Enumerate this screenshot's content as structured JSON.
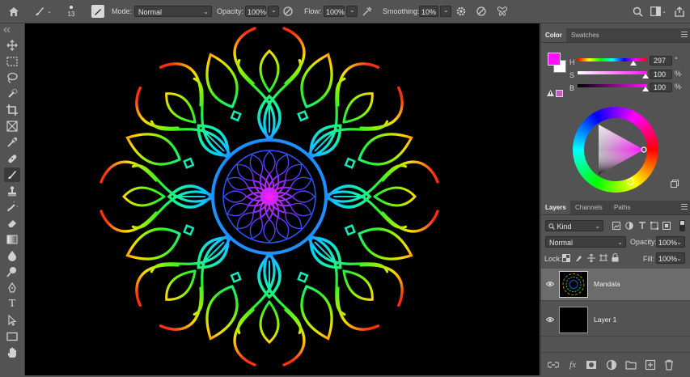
{
  "options_bar": {
    "brush_size": "13",
    "mode_label": "Mode:",
    "mode_value": "Normal",
    "opacity_label": "Opacity:",
    "opacity_value": "100%",
    "flow_label": "Flow:",
    "flow_value": "100%",
    "smoothing_label": "Smoothing:",
    "smoothing_value": "10%"
  },
  "color_panel": {
    "tabs": [
      "Color",
      "Swatches"
    ],
    "foreground_color": "#ff11ff",
    "background_color": "#ffffff",
    "h_label": "H",
    "h_value": "297",
    "h_unit": "°",
    "s_label": "S",
    "s_value": "100",
    "s_unit": "%",
    "b_label": "B",
    "b_value": "100",
    "b_unit": "%"
  },
  "layers_panel": {
    "tabs": [
      "Layers",
      "Channels",
      "Paths"
    ],
    "filter_value": "Kind",
    "blend_mode": "Normal",
    "opacity_label": "Opacity:",
    "opacity_value": "100%",
    "lock_label": "Lock:",
    "fill_label": "Fill:",
    "fill_value": "100%",
    "layers": [
      {
        "name": "Mandala",
        "selected": true
      },
      {
        "name": "Layer 1",
        "selected": false
      }
    ],
    "footer_fx": "fx"
  },
  "toolbar": {
    "tools": [
      "move-tool-icon",
      "marquee-tool-icon",
      "lasso-tool-icon",
      "quick-select-icon",
      "crop-tool-icon",
      "frame-tool-icon",
      "eyedropper-icon",
      "healing-brush-icon",
      "brush-tool-icon",
      "clone-stamp-icon",
      "history-brush-icon",
      "eraser-icon",
      "gradient-tool-icon",
      "blur-tool-icon",
      "dodge-tool-icon",
      "pen-tool-icon",
      "type-tool-icon",
      "path-select-icon",
      "rectangle-tool-icon",
      "hand-tool-icon"
    ],
    "type_glyph": "T"
  },
  "colors": {
    "panel_bg": "#535353",
    "canvas_bg": "#000000",
    "accent": "#ff11ff"
  }
}
